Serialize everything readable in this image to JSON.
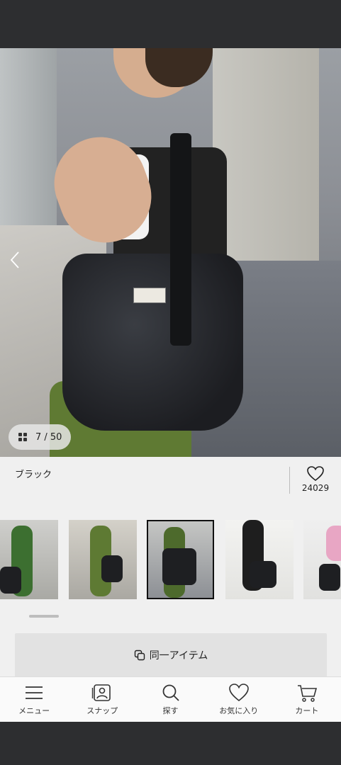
{
  "gallery": {
    "counter": "7 / 50",
    "grid_icon": "grid-icon",
    "prev_icon": "chevron-left-icon"
  },
  "product": {
    "color_name": "ブラック",
    "favorite_count": "24029"
  },
  "thumbnails": [
    {
      "id": "thumb-1",
      "selected": false
    },
    {
      "id": "thumb-2",
      "selected": false
    },
    {
      "id": "thumb-3",
      "selected": true
    },
    {
      "id": "thumb-4",
      "selected": false
    },
    {
      "id": "thumb-5",
      "selected": false
    }
  ],
  "actions": {
    "same_item_label": "同一アイテム"
  },
  "bottom_nav": {
    "items": [
      {
        "label": "メニュー",
        "icon": "menu-icon"
      },
      {
        "label": "スナップ",
        "icon": "snap-icon"
      },
      {
        "label": "探す",
        "icon": "search-icon"
      },
      {
        "label": "お気に入り",
        "icon": "heart-icon"
      },
      {
        "label": "カート",
        "icon": "cart-icon"
      }
    ]
  },
  "colors": {
    "background": "#f0f0f0",
    "button": "#e2e2e2",
    "text": "#222222"
  }
}
